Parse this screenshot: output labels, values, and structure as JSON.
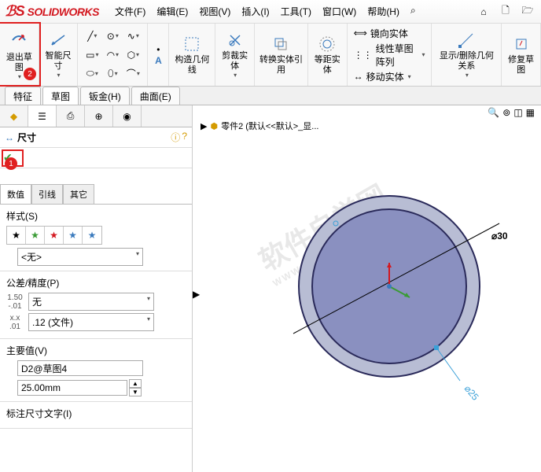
{
  "app": {
    "name": "SOLIDWORKS"
  },
  "menu": [
    "文件(F)",
    "编辑(E)",
    "视图(V)",
    "插入(I)",
    "工具(T)",
    "窗口(W)",
    "帮助(H)"
  ],
  "ribbon": {
    "exit_sketch": "退出草图",
    "smart_dim": "智能尺寸",
    "trim_entity": "剪裁实体",
    "convert_entity": "转换实体引用",
    "offset_entity": "等距实体",
    "geom_rel": "构造几何线",
    "mirror": "镜向实体",
    "pattern": "线性草图阵列",
    "move": "移动实体",
    "disp_del": "显示/删除几何关系",
    "repair": "修复草图"
  },
  "tabs": [
    "特征",
    "草图",
    "钣金(H)",
    "曲面(E)"
  ],
  "side": {
    "title": "尺寸",
    "subtabs": [
      "数值",
      "引线",
      "其它"
    ],
    "style_label": "样式(S)",
    "style_value": "<无>",
    "tol_label": "公差/精度(P)",
    "tol_value": "无",
    "precision_value": ".12 (文件)",
    "main_label": "主要值(V)",
    "main_name": "D2@草图4",
    "main_value": "25.00mm",
    "dimtext_label": "标注尺寸文字(I)"
  },
  "viewport": {
    "part_label": "零件2 (默认<<默认>_显...",
    "dim_outer": "⌀30",
    "dim_inner": "⌀25"
  },
  "watermark": "软件自学网",
  "watermark_sub": "WWW.RJZXW.COM",
  "annotations": {
    "num1": "1",
    "num2": "2"
  }
}
